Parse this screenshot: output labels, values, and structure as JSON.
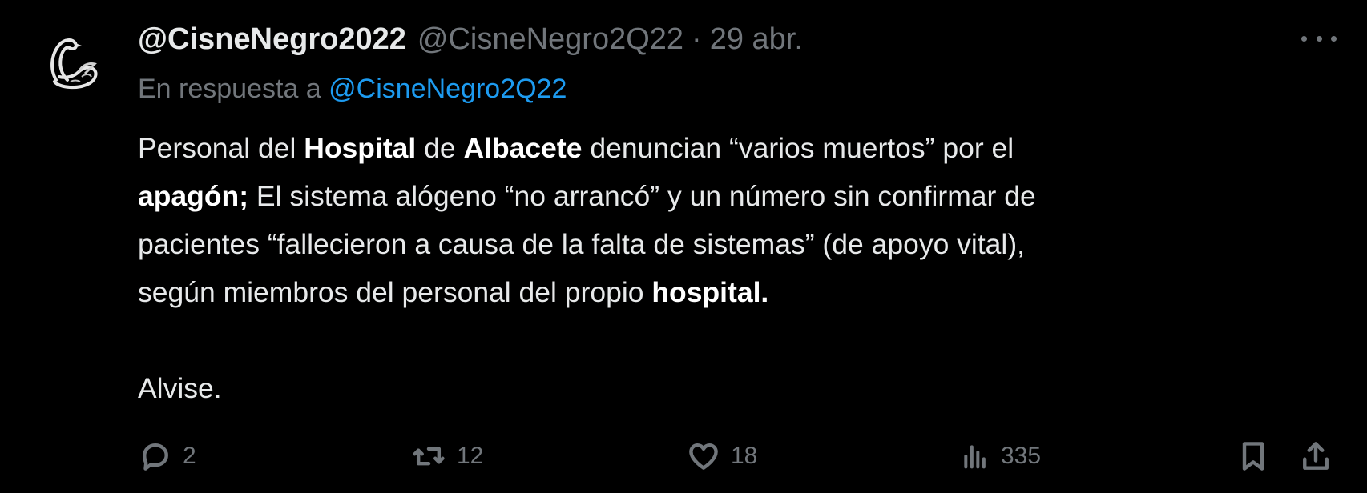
{
  "tweet": {
    "author": {
      "display_name": "@CisneNegro2022",
      "handle": "@CisneNegro2Q22",
      "separator": "·",
      "date": "29 abr."
    },
    "reply": {
      "prefix": "En respuesta a",
      "target": "@CisneNegro2Q22"
    },
    "body": {
      "l1_a": "Personal del ",
      "l1_b": "Hospital",
      "l1_c": " de ",
      "l1_d": "Albacete",
      "l1_e": " denuncian “varios muertos” por el",
      "l2_a": "apagón;",
      "l2_b": " El sistema alógeno “no arrancó” y un número sin confirmar de",
      "l3": "pacientes “fallecieron a causa de la falta de sistemas” (de apoyo vital),",
      "l4_a": "según miembros del personal del propio ",
      "l4_b": "hospital.",
      "l5": "Alvise."
    },
    "stats": {
      "replies": "2",
      "retweets": "12",
      "likes": "18",
      "views": "335"
    },
    "icons": {
      "reply": "reply-icon",
      "retweet": "retweet-icon",
      "like": "heart-icon",
      "views": "views-icon",
      "bookmark": "bookmark-icon",
      "share": "share-icon",
      "more": "more-icon"
    },
    "colors": {
      "background": "#000000",
      "text": "#e7e9ea",
      "muted": "#71767b",
      "link": "#1d9bf0"
    }
  }
}
